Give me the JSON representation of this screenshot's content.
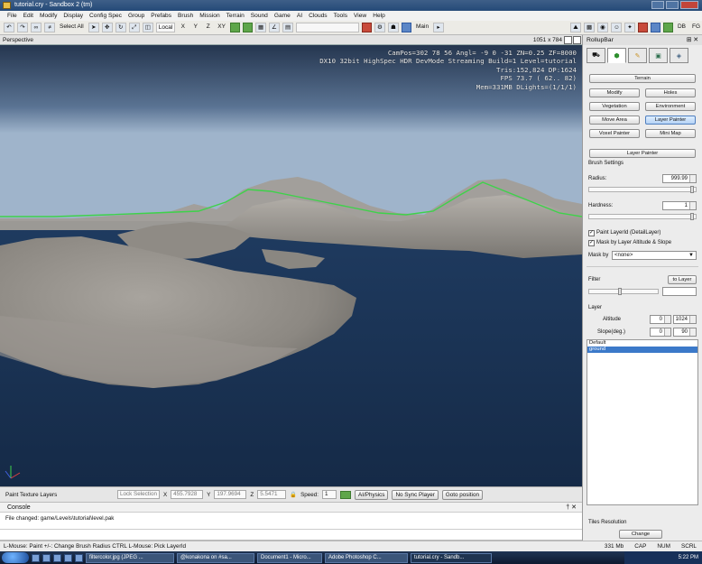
{
  "window": {
    "title": "tutorial.cry - Sandbox 2 (tm)"
  },
  "menu": [
    "File",
    "Edit",
    "Modify",
    "Display",
    "Config Spec",
    "Group",
    "Prefabs",
    "Brush",
    "Mission",
    "Terrain",
    "Sound",
    "Game",
    "AI",
    "Clouds",
    "Tools",
    "View",
    "Help"
  ],
  "toolbar": {
    "select_all": "Select All",
    "coord_local": "Local",
    "axis_x": "X",
    "axis_y": "Y",
    "axis_z": "Z",
    "axis_xy": "XY",
    "main_label": "Main"
  },
  "viewport": {
    "name": "Perspective",
    "resolution": "1051 x 784",
    "hud": [
      "CamPos=302  78  56 Angl= -9   0 -31 ZN=0.25 ZF=8000",
      "DX10 32bit HighSpec HDR DevMode Streaming Build=1 Level=tutorial",
      "Tris:152,824  DP:1624",
      "FPS  73.7 ( 62.. 82)",
      "Mem=331MB DLights=(1/1/1)"
    ],
    "colors": {
      "sky_top": "#2a3a54",
      "sky_horizon": "#8aa2bf",
      "water": "#1e3656",
      "terrain": "#9a968f",
      "brush_line": "#3ed24a"
    }
  },
  "status": {
    "mode": "Paint Texture Layers",
    "lock_selection": "Lock Selection",
    "x_label": "X",
    "x_value": "455.7928",
    "y_label": "Y",
    "y_value": "197.9694",
    "z_label": "Z",
    "z_value": "5.5471",
    "speed_label": "Speed:",
    "speed_value": "1",
    "ai_physics": "AI/Physics",
    "no_sync_player": "No Sync Player",
    "goto_position": "Goto position"
  },
  "console": {
    "title": "Console",
    "close": "✕",
    "pin": "†",
    "message": "File changed: game/Levels\\tutorial\\level.pak"
  },
  "hint": {
    "text": "L-Mouse: Paint  +/-: Change Brush Radius  CTRL L-Mouse: Pick LayerId",
    "memory": "331 Mb",
    "cap": "CAP",
    "num": "NUM",
    "scrl": "SCRL"
  },
  "rollup": {
    "title": "RollupBar",
    "terrain_btn": "Terrain",
    "buttons": [
      "Modify",
      "Holes",
      "Vegetation",
      "Environment",
      "Move Area",
      "Layer Painter",
      "Voxel Painter",
      "Mini Map"
    ],
    "layer_painter": "Layer Painter",
    "brush_settings": "Brush Settings",
    "radius_label": "Radius:",
    "radius_value": "999.99",
    "hardness_label": "Hardness:",
    "hardness_value": "1",
    "paint_layer_id": "Paint LayerId (DetailLayer)",
    "mask_altitude": "Mask by Layer Altitude & Slope",
    "mask_by_label": "Mask by",
    "mask_by_value": "<none>",
    "filter_label": "Filter",
    "filter_btn": "to Layer",
    "layer_label": "Layer",
    "altitude_label": "Altitude",
    "altitude_min": "0",
    "altitude_max": "1024",
    "slope_label": "Slope(deg.)",
    "slope_min": "0",
    "slope_max": "90",
    "layers": [
      "Default",
      "ground"
    ],
    "tiles_resolution": "Tiles Resolution",
    "change_btn": "Change"
  },
  "taskbar": {
    "tasks": [
      "filtercolor.jpg (JPEG ...",
      "@konakona on #sa...",
      "Document1 - Micro...",
      "Adobe Photoshop C...",
      "tutorial.cry - Sandb..."
    ],
    "clock": "5:22 PM"
  }
}
